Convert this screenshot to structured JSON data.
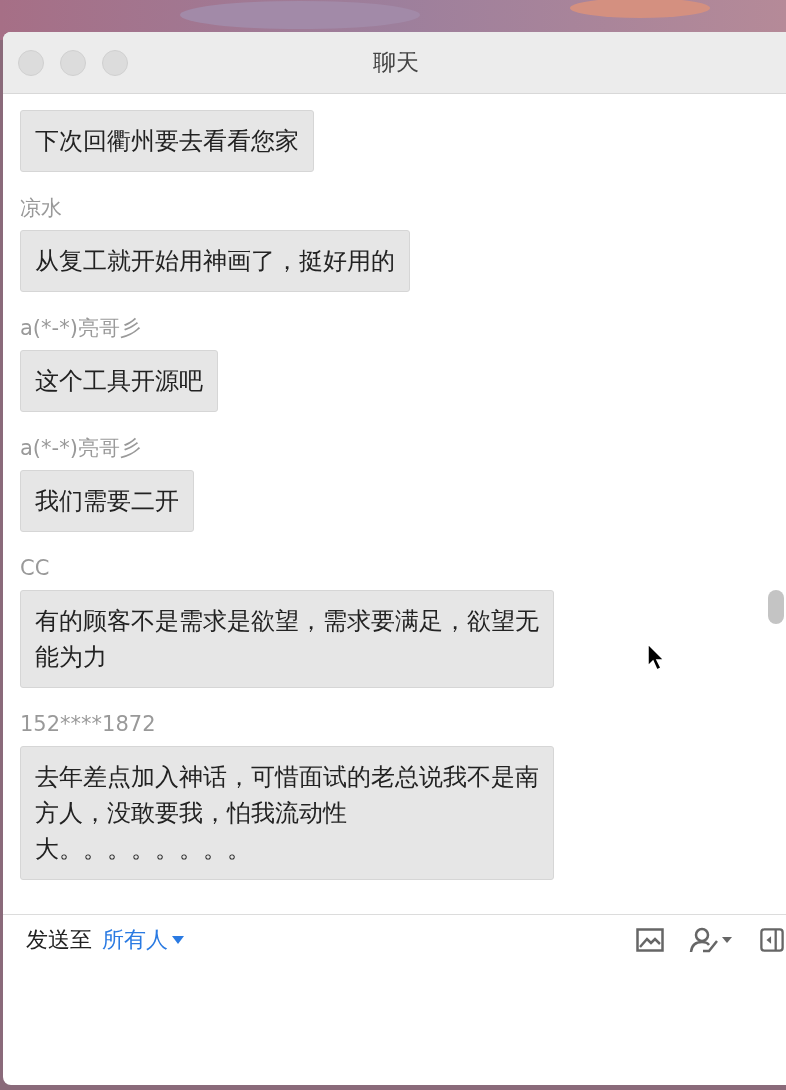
{
  "window": {
    "title": "聊天"
  },
  "messages": [
    {
      "text": "下次回衢州要去看看您家"
    },
    {
      "sender": "凉水",
      "text": "从复工就开始用神画了，挺好用的"
    },
    {
      "sender": "a(*-*)亮哥彡",
      "text": "这个工具开源吧"
    },
    {
      "sender": "a(*-*)亮哥彡",
      "text": "我们需要二开"
    },
    {
      "sender": "CC",
      "text": "有的顾客不是需求是欲望，需求要满足，欲望无能为力"
    },
    {
      "sender": "152****1872",
      "lines": [
        "去年差点加入神话，可惜面试的老总说我不是南方人，没敢要我，怕我流动性",
        "大。。。。。。。。"
      ]
    }
  ],
  "composer": {
    "send_to_label": "发送至",
    "recipient": "所有人"
  }
}
